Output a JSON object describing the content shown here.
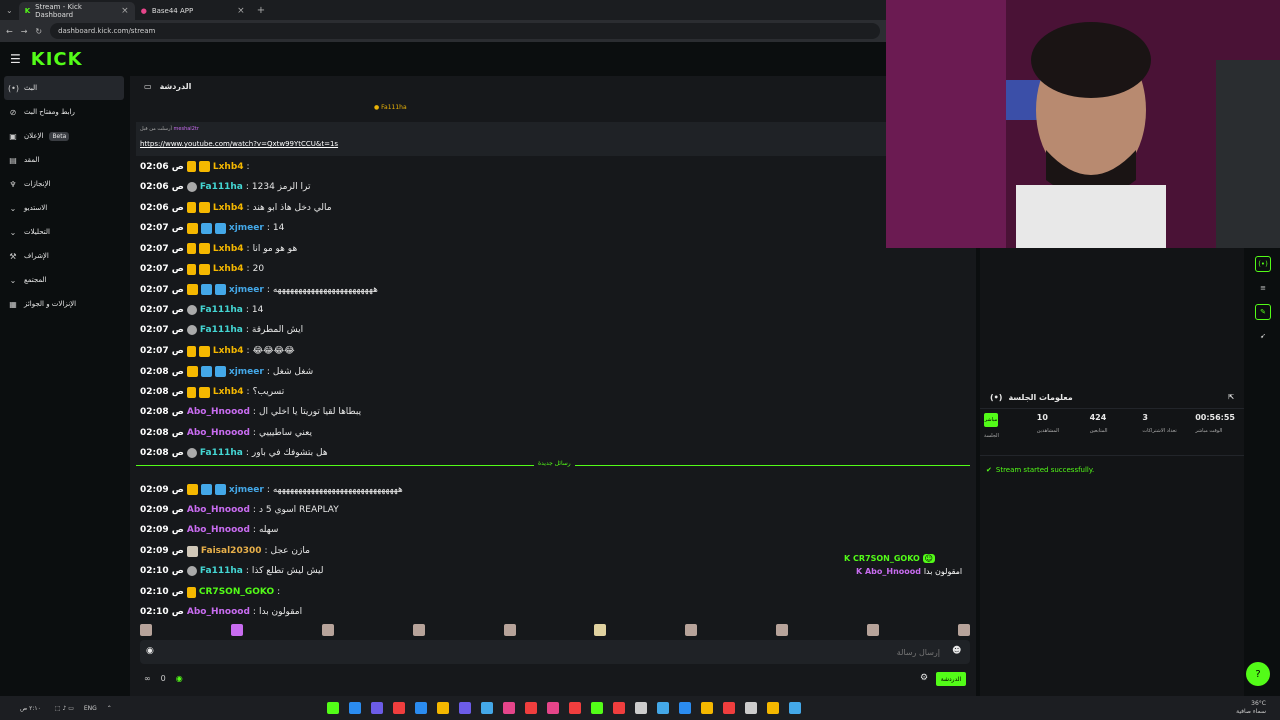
{
  "browser": {
    "tabs": [
      {
        "label": "Stream - Kick Dashboard"
      },
      {
        "label": "Base44 APP"
      }
    ],
    "url": "dashboard.kick.com/stream"
  },
  "header": {
    "logo": "KICK"
  },
  "sidebar": {
    "items": [
      {
        "label": "البث",
        "icon": "live-icon",
        "active": true
      },
      {
        "label": "رابط ومفتاح البث",
        "icon": "link-icon"
      },
      {
        "label": "الإعلان",
        "icon": "ad-icon",
        "badge": "Beta"
      },
      {
        "label": "المقد",
        "icon": "moderation-icon"
      },
      {
        "label": "الإنجازات",
        "icon": "trophy-icon"
      },
      {
        "label": "الاستديو",
        "icon": "studio-icon"
      },
      {
        "label": "التحليلات",
        "icon": "chart-icon"
      },
      {
        "label": "الإشراف",
        "icon": "hammer-icon"
      },
      {
        "label": "المجتمع",
        "icon": "community-icon"
      },
      {
        "label": "الإنزالات و الجوائز",
        "icon": "drop-icon"
      }
    ]
  },
  "chat": {
    "title": "الدردشة",
    "pinned": {
      "author": "Fa111ha",
      "meta": "أرسلت من قبل",
      "meta_user": "meshal2tr",
      "link": "https://www.youtube.com/watch?v=Qxtw99YtCCU&t=1s"
    },
    "messages": [
      {
        "time": "02:06 ص",
        "user": "Lxhb4",
        "color": "#f5b800",
        "text": ""
      },
      {
        "time": "02:06 ص",
        "user": "Fa111ha",
        "color": "#44d7d4",
        "text": "ترا الرمز 1234"
      },
      {
        "time": "02:06 ص",
        "user": "Lxhb4",
        "color": "#f5b800",
        "text": "مالي دخل هاذ ابو هند"
      },
      {
        "time": "02:07 ص",
        "user": "xjmeer",
        "color": "#44a8e8",
        "text": "14"
      },
      {
        "time": "02:07 ص",
        "user": "Lxhb4",
        "color": "#f5b800",
        "text": "هو هو مو انا"
      },
      {
        "time": "02:07 ص",
        "user": "Lxhb4",
        "color": "#f5b800",
        "text": "20"
      },
      {
        "time": "02:07 ص",
        "user": "xjmeer",
        "color": "#44a8e8",
        "text": "ههههههههههههههههههههههههه"
      },
      {
        "time": "02:07 ص",
        "user": "Fa111ha",
        "color": "#44d7d4",
        "text": "14"
      },
      {
        "time": "02:07 ص",
        "user": "Fa111ha",
        "color": "#44d7d4",
        "text": "ايش المطرقة"
      },
      {
        "time": "02:07 ص",
        "user": "Lxhb4",
        "color": "#f5b800",
        "text": "😂😂😂😂"
      },
      {
        "time": "02:08 ص",
        "user": "xjmeer",
        "color": "#44a8e8",
        "text": "شغل شغل"
      },
      {
        "time": "02:08 ص",
        "user": "Lxhb4",
        "color": "#f5b800",
        "text": "تسريب؟"
      },
      {
        "time": "02:08 ص",
        "user": "Abo_Hnoood",
        "color": "#c86cf0",
        "text": "يبطاها لقيا توريتا يا اخلي ال"
      },
      {
        "time": "02:08 ص",
        "user": "Abo_Hnoood",
        "color": "#c86cf0",
        "text": "يعني ساطيييي"
      },
      {
        "time": "02:08 ص",
        "user": "Fa111ha",
        "color": "#44d7d4",
        "text": "هل بتشوفك في باور"
      },
      {
        "time": "02:09 ص",
        "user": "xjmeer",
        "color": "#44a8e8",
        "text": "ههههههههههههههههههههههههههههههه"
      },
      {
        "time": "02:09 ص",
        "user": "Abo_Hnoood",
        "color": "#c86cf0",
        "text": "اسوي 5 د REAPLAY"
      },
      {
        "time": "02:09 ص",
        "user": "Abo_Hnoood",
        "color": "#c86cf0",
        "text": "سهله"
      },
      {
        "time": "02:09 ص",
        "user": "Faisal20300",
        "color": "#e8b04a",
        "text": "مازن عجل"
      },
      {
        "time": "02:10 ص",
        "user": "Fa111ha",
        "color": "#44d7d4",
        "text": "ليش ليش تطلع كذا"
      },
      {
        "time": "02:10 ص",
        "user": "CR7SON_GOKO",
        "color": "#53fc18",
        "text": ""
      },
      {
        "time": "02:10 ص",
        "user": "Abo_Hnoood",
        "color": "#c86cf0",
        "text": "امقولون بدا"
      }
    ],
    "new_messages_label": "رسائل جديدة",
    "overlay": [
      {
        "user": "CR7SON_GOKO",
        "text": ""
      },
      {
        "user": "Abo_Hnoood",
        "text": "امقولون بدا"
      }
    ],
    "input_placeholder": "إرسال رسالة",
    "send_label": "الدردشة",
    "viewer_count": "0"
  },
  "session": {
    "title": "معلومات الجلسة",
    "live_label": "مباشر",
    "session_label": "الجلسة",
    "stats": [
      {
        "value": "10",
        "label": "المشاهدين"
      },
      {
        "value": "424",
        "label": "المتابعين"
      },
      {
        "value": "3",
        "label": "تعداد الاشتراكات"
      },
      {
        "value": "00:56:55",
        "label": "الوقت مباشر"
      }
    ],
    "status": "Stream started successfully."
  },
  "taskbar": {
    "time": "٢:١٠ ص",
    "date": "٢٥/٠٢/١٤",
    "lang": "ENG",
    "weather": "36°C",
    "weather_desc": "سماء صافية"
  }
}
